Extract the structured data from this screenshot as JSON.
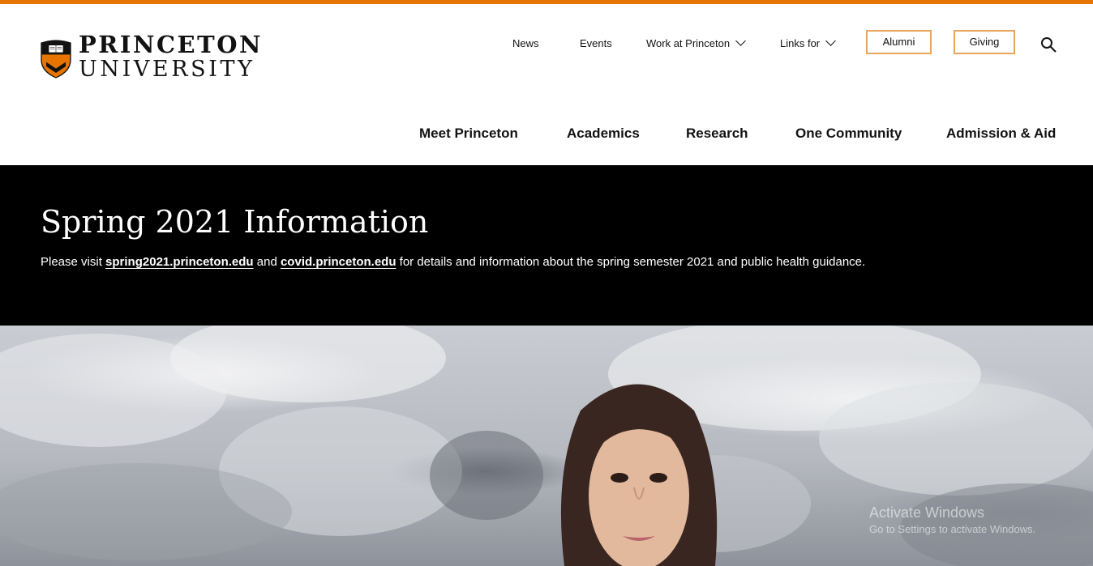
{
  "brand": {
    "wordmark_line1": "PRINCETON",
    "wordmark_line2": "UNIVERSITY",
    "accent_color": "#e77500",
    "shield_orange": "#e77500",
    "shield_black": "#121212"
  },
  "utility_nav": {
    "news": "News",
    "events": "Events",
    "work": "Work at Princeton",
    "links_for": "Links for",
    "alumni": "Alumni",
    "giving": "Giving",
    "search_icon": "search-icon",
    "button_border_color": "#e8a55b"
  },
  "main_nav": [
    "Meet Princeton",
    "Academics",
    "Research",
    "One Community",
    "Admission & Aid"
  ],
  "notice": {
    "title": "Spring 2021 Information",
    "text_before": "Please visit ",
    "link1": "spring2021.princeton.edu",
    "text_middle": " and ",
    "link2": "covid.princeton.edu",
    "text_after": " for details and information about the spring semester 2021 and public health guidance."
  },
  "os_watermark": {
    "title": "Activate Windows",
    "subtitle": "Go to Settings to activate Windows."
  }
}
